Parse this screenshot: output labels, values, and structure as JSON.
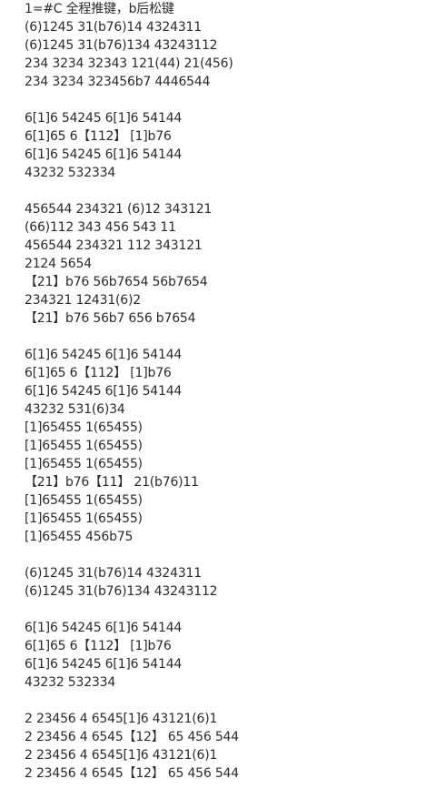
{
  "lines": [
    "1=#C 全程推键，b后松键",
    "(6)1245 31(b76)14 4324311",
    "(6)1245 31(b76)134 43243112",
    "234 3234 32343 121(44) 21(456)",
    "234 3234 323456b7 4446544",
    "",
    "6[1]6 54245 6[1]6 54144",
    "6[1]65 6【112】 [1]b76",
    "6[1]6 54245 6[1]6 54144",
    "43232 532334",
    "",
    "456544 234321 (6)12 343121",
    "(66)112 343 456 543 11",
    "456544 234321 112 343121",
    "2124 5654",
    "【21】b76 56b7654 56b7654",
    "234321 12431(6)2",
    "【21】b76 56b7 656 b7654",
    "",
    "6[1]6 54245 6[1]6 54144",
    "6[1]65 6【112】 [1]b76",
    "6[1]6 54245 6[1]6 54144",
    "43232 531(6)34",
    "[1]65455 1(65455)",
    "[1]65455 1(65455)",
    "[1]65455 1(65455)",
    "【21】b76【11】 21(b76)11",
    "[1]65455 1(65455)",
    "[1]65455 1(65455)",
    "[1]65455 456b75",
    "",
    "(6)1245 31(b76)14 4324311",
    "(6)1245 31(b76)134 43243112",
    "",
    "6[1]6 54245 6[1]6 54144",
    "6[1]65 6【112】 [1]b76",
    "6[1]6 54245 6[1]6 54144",
    "43232 532334",
    "",
    "2 23456 4 6545[1]6 43121(6)1",
    "2 23456 4 6545【12】 65 456 544",
    "2 23456 4 6545[1]6 43121(6)1",
    "2 23456 4 6545【12】 65 456 544"
  ]
}
